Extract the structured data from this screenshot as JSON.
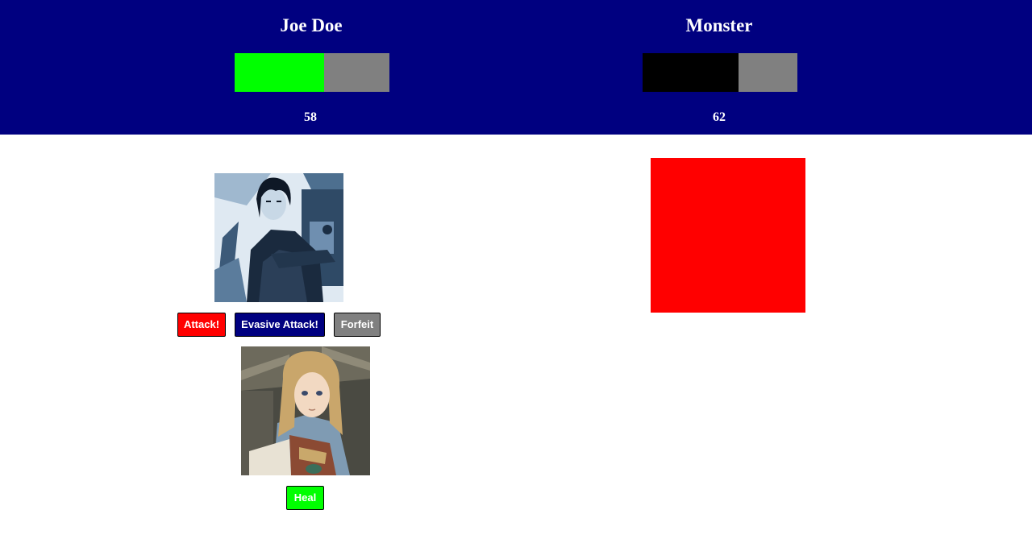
{
  "player": {
    "name": "Joe Doe",
    "hp": "58",
    "hp_fraction": 0.58,
    "bar_fill_color": "#00ff00",
    "bar_empty_color": "#808080",
    "portrait": "dark-haired-warrior-portrait"
  },
  "monster": {
    "name": "Monster",
    "hp": "62",
    "hp_fraction": 0.62,
    "bar_fill_color": "#000000",
    "bar_empty_color": "#808080",
    "sprite_color": "#ff0000"
  },
  "ally": {
    "portrait": "blonde-healer-with-book-portrait"
  },
  "actions": {
    "attack_label": "Attack!",
    "evasive_label": "Evasive Attack!",
    "forfeit_label": "Forfeit",
    "heal_label": "Heal"
  },
  "colors": {
    "header_bg": "#000080",
    "attack": "#ff0000",
    "evasive": "#000080",
    "forfeit": "#808080",
    "heal": "#00ff00"
  }
}
